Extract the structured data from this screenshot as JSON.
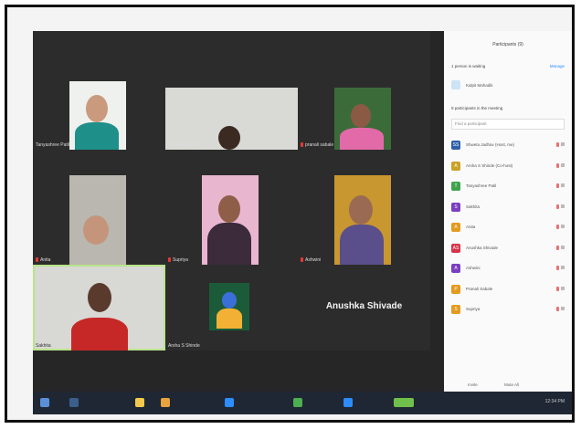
{
  "participants_panel": {
    "title": "Participants (9)",
    "waiting_text": "1 person is waiting",
    "manage_label": "Manage",
    "waiting_person": "Kalpit Mahadik",
    "count_text": "9 participants in the meeting",
    "search_placeholder": "Find a participant",
    "participants": [
      {
        "initial": "SS",
        "name": "Shweta Jadhav (Host, me)",
        "color": "#2e5ea8"
      },
      {
        "initial": "A",
        "name": "Arsha S Shinde (Co-host)",
        "color": "#c9a227"
      },
      {
        "initial": "T",
        "name": "Tanyashree Patil",
        "color": "#3fa34d"
      },
      {
        "initial": "S",
        "name": "Sakhita",
        "color": "#7b3fbf"
      },
      {
        "initial": "A",
        "name": "Anita",
        "color": "#e39b1f"
      },
      {
        "initial": "AS",
        "name": "Anushka Shivade",
        "color": "#d8334a"
      },
      {
        "initial": "A",
        "name": "Ashwini",
        "color": "#7b3fbf"
      },
      {
        "initial": "P",
        "name": "Pranali Sabale",
        "color": "#e39b1f"
      },
      {
        "initial": "S",
        "name": "Supriya",
        "color": "#e39b1f"
      }
    ],
    "footer": {
      "invite": "Invite",
      "mute_all": "Mute All"
    }
  },
  "gallery": {
    "tiles": [
      {
        "name": "Tanyashree Patil"
      },
      {
        "name": "Shweta Jadhav"
      },
      {
        "name": "pranali sabale"
      },
      {
        "name": "Anita"
      },
      {
        "name": "Supriya"
      },
      {
        "name": "Ashwini"
      },
      {
        "name": "Sakhita"
      },
      {
        "name": "Arsha S Shinde"
      },
      {
        "name": "Anushka Shivade"
      }
    ],
    "big_name": "Anushka Shivade"
  },
  "taskbar": {
    "clock": "12:34 PM"
  },
  "colors": {
    "accent": "#2d8cff",
    "active_speaker": "#b9e48a",
    "muted_mic": "#e53935"
  }
}
